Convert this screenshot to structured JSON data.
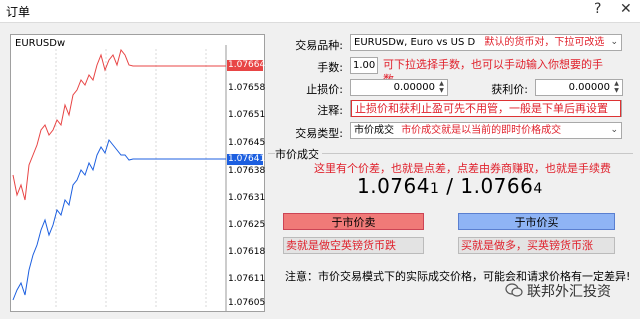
{
  "window": {
    "title": "订单"
  },
  "chart": {
    "symbol": "EURUSDw",
    "ask_price_tag": "1.07664",
    "bid_price_tag": "1.07641",
    "price_ticks": [
      "1.07658",
      "1.07651",
      "1.07645",
      "1.07638",
      "1.07631",
      "1.07625",
      "1.07618",
      "1.07611",
      "1.07605"
    ],
    "ask_color": "#e84545",
    "bid_color": "#1c5fe0"
  },
  "form": {
    "symbol_label": "交易品种:",
    "symbol_value": "EURUSDw, Euro vs US D",
    "symbol_note": "默认的货币对，下拉可改选",
    "volume_label": "手数:",
    "volume_value": "1.00",
    "volume_note": "可下拉选择手数，也可以手动输入你想要的手数",
    "sl_label": "止损价:",
    "sl_value": "0.00000",
    "tp_label": "获利价:",
    "tp_value": "0.00000",
    "comment_label": "注释:",
    "comment_note": "止损价和获利止盈可先不用管，一般是下单后再设置",
    "type_label": "交易类型:",
    "type_value": "市价成交",
    "type_note": "市价成交就是以当前的即时价格成交"
  },
  "market": {
    "group_title": "市价成交",
    "spread_note": "这里有个价差，也就是点差，点差由券商赚取，也就是手续费",
    "bid_main": "1.0764",
    "bid_small": "1",
    "separator": "/",
    "ask_main": "1.0766",
    "ask_small": "4",
    "sell_button": "于市价卖",
    "buy_button": "于市价买",
    "sell_note": "卖就是做空英镑货币跌",
    "buy_note": "买就是做多，买英镑货币涨",
    "warning": "注意：市价交易模式下的实际成交价格，可能会和请求价格有一定差异!"
  },
  "watermark": {
    "text": "联邦外汇投资"
  }
}
